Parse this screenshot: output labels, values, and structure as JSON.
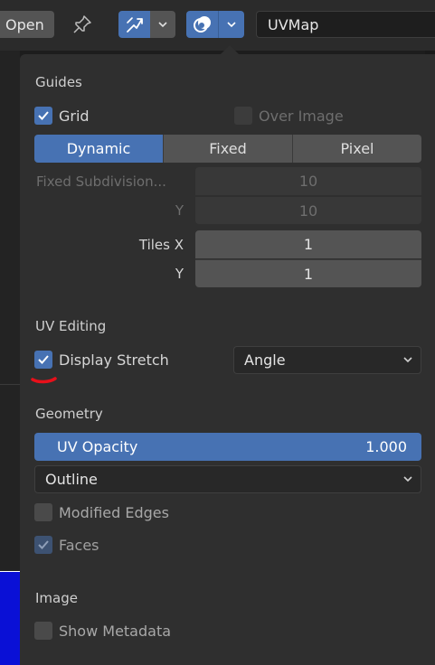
{
  "header": {
    "open_label": "Open",
    "uvmap_label": "UVMap"
  },
  "icons": {
    "pin": "pin-icon",
    "sync": "uv-sync-icon",
    "overlay": "overlay-icon",
    "dropdown": "chevron-down-icon",
    "check": "checkmark-icon"
  },
  "guides": {
    "title": "Guides",
    "grid_label": "Grid",
    "grid_checked": true,
    "over_image_label": "Over Image",
    "over_image_checked": false,
    "grid_modes": [
      "Dynamic",
      "Fixed",
      "Pixel"
    ],
    "grid_mode_selected": "Dynamic",
    "fixed_subdiv_label": "Fixed Subdivision...",
    "fixed_subdiv_x": "10",
    "fixed_subdiv_y_label": "Y",
    "fixed_subdiv_y": "10",
    "tiles_x_label": "Tiles X",
    "tiles_x": "1",
    "tiles_y_label": "Y",
    "tiles_y": "1"
  },
  "uv_editing": {
    "title": "UV Editing",
    "display_stretch_label": "Display Stretch",
    "display_stretch_checked": true,
    "stretch_mode": "Angle"
  },
  "geometry": {
    "title": "Geometry",
    "uv_opacity_label": "UV Opacity",
    "uv_opacity_value": "1.000",
    "edge_display": "Outline",
    "modified_edges_label": "Modified Edges",
    "modified_edges_checked": false,
    "faces_label": "Faces",
    "faces_checked": true
  },
  "image": {
    "title": "Image",
    "show_metadata_label": "Show Metadata",
    "show_metadata_checked": false
  },
  "colors": {
    "accent": "#4772b3",
    "panel_bg": "#2f2f2f",
    "annotation_red": "#e8101a"
  }
}
